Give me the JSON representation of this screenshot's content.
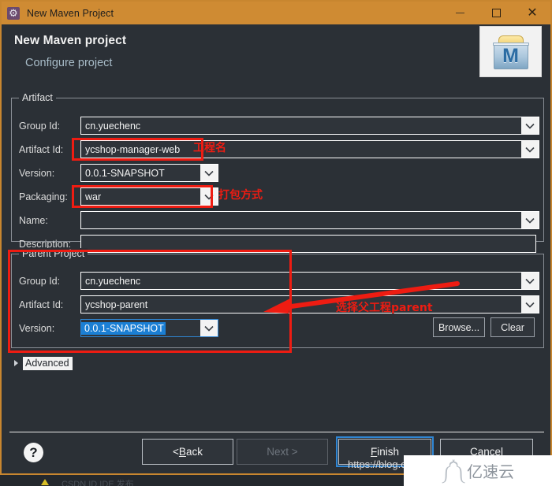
{
  "window": {
    "title": "New Maven Project",
    "icon": "gear-icon",
    "controls": {
      "minimize": "–",
      "maximize": "□",
      "close": "✕"
    },
    "frame_color": "#c8862f",
    "titlebar_color": "#cf8b33"
  },
  "header": {
    "title": "New Maven project",
    "subtitle": "Configure project",
    "logo_letter": "M"
  },
  "artifact": {
    "legend": "Artifact",
    "fields": [
      {
        "label": "Group Id:",
        "value": "cn.yuechenc",
        "type": "combo",
        "width": "full"
      },
      {
        "label": "Artifact Id:",
        "value": "ycshop-manager-web",
        "type": "combo",
        "width": "full"
      },
      {
        "label": "Version:",
        "value": "0.0.1-SNAPSHOT",
        "type": "combo",
        "width": "short"
      },
      {
        "label": "Packaging:",
        "value": "war",
        "type": "combo",
        "width": "short"
      },
      {
        "label": "Name:",
        "value": "",
        "type": "combo",
        "width": "full"
      },
      {
        "label": "Description:",
        "value": "",
        "type": "text",
        "width": "full"
      }
    ]
  },
  "parent": {
    "legend": "Parent Project",
    "fields": [
      {
        "label": "Group Id:",
        "value": "cn.yuechenc",
        "type": "text",
        "width": "full"
      },
      {
        "label": "Artifact Id:",
        "value": "ycshop-parent",
        "type": "text",
        "width": "full"
      },
      {
        "label": "Version:",
        "value": "0.0.1-SNAPSHOT",
        "type": "combo",
        "width": "short",
        "selected": true
      }
    ],
    "browse_label": "Browse...",
    "clear_label": "Clear"
  },
  "advanced": {
    "label": "Advanced",
    "expanded": false
  },
  "annotations": {
    "color": "#ee1c12",
    "artifact_id_note": "工程名",
    "packaging_note": "打包方式",
    "parent_note": "选择父工程parent"
  },
  "footer": {
    "help_glyph": "?",
    "buttons": [
      {
        "name": "back",
        "pre": "< ",
        "accel": "B",
        "post": "ack",
        "state": "enabled"
      },
      {
        "name": "next",
        "pre": "",
        "accel": "",
        "post": "Next >",
        "state": "disabled"
      },
      {
        "name": "finish",
        "pre": "",
        "accel": "F",
        "post": "inish",
        "state": "focused"
      },
      {
        "name": "cancel",
        "pre": "",
        "accel": "",
        "post": "Cancel",
        "state": "enabled"
      }
    ]
  },
  "watermarks": {
    "csdn_url": "https://blog.csdn.net/",
    "brand_text": "亿速云",
    "brand_glyph": "༼༽"
  },
  "underbar": {
    "ghost_text": "CSDN    ID    IDE         发布"
  }
}
